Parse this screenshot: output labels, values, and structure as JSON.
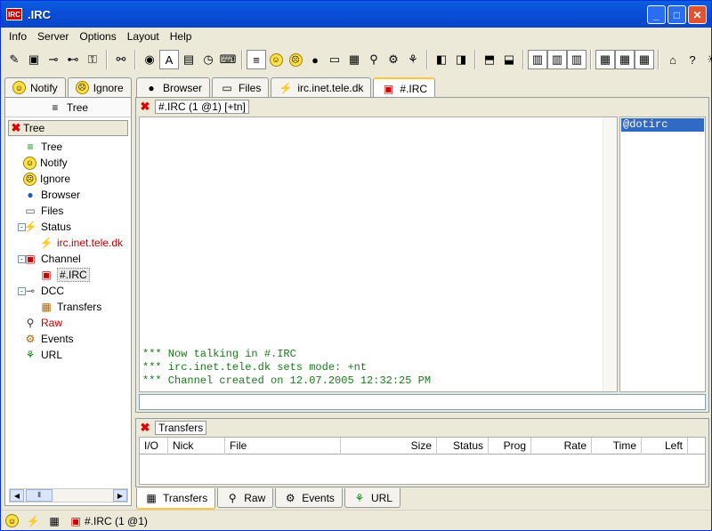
{
  "window": {
    "title": ".IRC",
    "app_icon": "IRC"
  },
  "menu": [
    "Info",
    "Server",
    "Options",
    "Layout",
    "Help"
  ],
  "left_tabs": [
    {
      "label": "Notify"
    },
    {
      "label": "Ignore"
    }
  ],
  "left_panel": {
    "header": "Tree",
    "tree_header": "Tree",
    "tree": [
      {
        "label": "Tree",
        "color": "#000",
        "indent": 1
      },
      {
        "label": "Notify",
        "color": "#000",
        "indent": 1
      },
      {
        "label": "Ignore",
        "color": "#000",
        "indent": 1
      },
      {
        "label": "Browser",
        "color": "#000",
        "indent": 1
      },
      {
        "label": "Files",
        "color": "#000",
        "indent": 1
      },
      {
        "label": "Status",
        "color": "#000",
        "indent": 1,
        "expander": "-"
      },
      {
        "label": "irc.inet.tele.dk",
        "color": "#c00000",
        "indent": 2
      },
      {
        "label": "Channel",
        "color": "#000",
        "indent": 1,
        "expander": "-"
      },
      {
        "label": "#.IRC",
        "color": "#000",
        "indent": 2,
        "selected": true
      },
      {
        "label": "DCC",
        "color": "#000",
        "indent": 1,
        "expander": "-"
      },
      {
        "label": "Transfers",
        "color": "#000",
        "indent": 2
      },
      {
        "label": "Raw",
        "color": "#c00000",
        "indent": 1
      },
      {
        "label": "Events",
        "color": "#000",
        "indent": 1
      },
      {
        "label": "URL",
        "color": "#000",
        "indent": 1
      }
    ]
  },
  "right_tabs": [
    {
      "label": "Browser"
    },
    {
      "label": "Files"
    },
    {
      "label": "irc.inet.tele.dk"
    },
    {
      "label": "#.IRC",
      "active": true
    }
  ],
  "channel": {
    "title": "#.IRC (1 @1) [+tn]",
    "messages": [
      "*** Now talking in #.IRC",
      "*** irc.inet.tele.dk sets mode: +nt",
      "*** Channel created on 12.07.2005 12:32:25 PM"
    ],
    "nicks": [
      "@dotirc"
    ],
    "input_value": ""
  },
  "transfers": {
    "title": "Transfers",
    "columns": [
      "I/O",
      "Nick",
      "File",
      "Size",
      "Status",
      "Prog",
      "Rate",
      "Time",
      "Left"
    ]
  },
  "bottom_tabs": [
    {
      "label": "Transfers",
      "active": true
    },
    {
      "label": "Raw"
    },
    {
      "label": "Events"
    },
    {
      "label": "URL"
    }
  ],
  "status": {
    "channel": "#.IRC (1 @1)"
  },
  "colors": {
    "chat_text": "#1a7a1a",
    "selection": "#316ac5",
    "accent": "#ffc83c"
  }
}
